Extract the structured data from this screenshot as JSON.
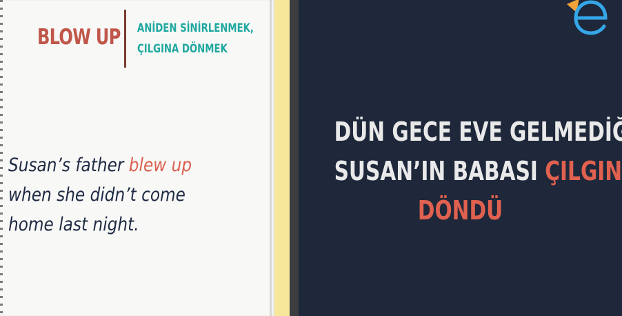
{
  "card": {
    "headword": "BLOW UP",
    "meaning_lines": [
      "ANİDEN SİNİRLENMEK,",
      "ÇILGINA DÖNMEK"
    ],
    "example": {
      "line1_before": "Susan’s father ",
      "line1_accent": "blew up",
      "line2": "when she didn’t come",
      "line3": "home last night."
    }
  },
  "translation": {
    "line1": "DÜN GECE EVE GELMEDİĞİNDE,",
    "line2_before": "SUSAN’IN BABASI ",
    "line2_accent": "ÇILGINA",
    "line3_accent": "DÖNDÜ"
  },
  "logo": {
    "icon": "e-letter-logo-icon"
  },
  "colors": {
    "headword": "#c0574a",
    "meaning": "#1fa8a0",
    "accent": "#d9604f",
    "example_text": "#1f2a44",
    "right_background": "#1e283a",
    "translation_text": "#e9e9ea",
    "divider": "#f6e79a",
    "logo_blue": "#35a7e8",
    "logo_orange": "#f2a23a"
  }
}
